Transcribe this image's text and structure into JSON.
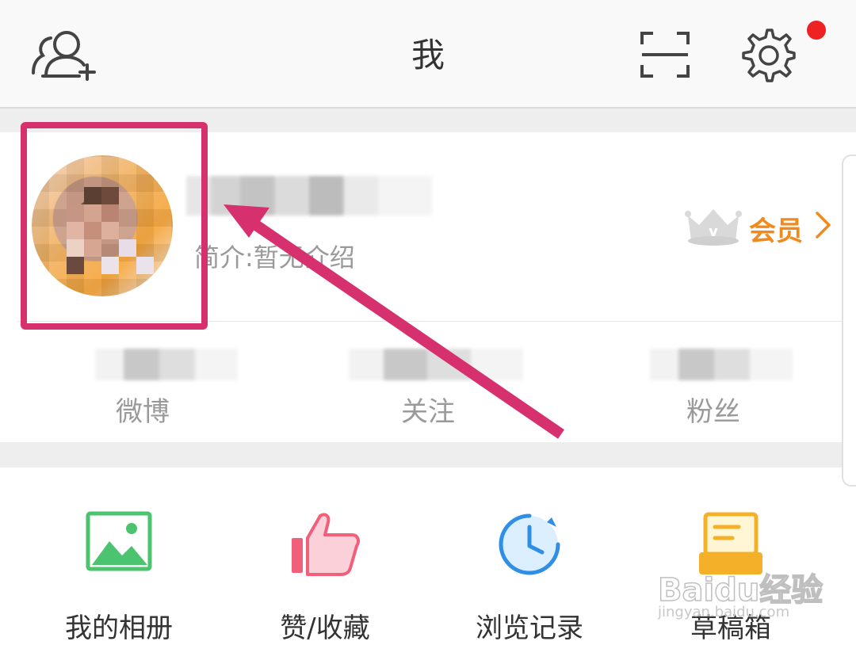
{
  "header": {
    "title": "我",
    "settings_badge_color": "#ee2222"
  },
  "profile": {
    "bio": "简介:暂无介绍",
    "vip_label": "会员",
    "accent_color": "#f08a1c"
  },
  "stats": [
    {
      "label": "微博"
    },
    {
      "label": "关注"
    },
    {
      "label": "粉丝"
    }
  ],
  "grid": [
    {
      "label": "我的相册",
      "icon": "photo-album-icon"
    },
    {
      "label": "赞/收藏",
      "icon": "thumbs-up-icon"
    },
    {
      "label": "浏览记录",
      "icon": "history-clock-icon"
    },
    {
      "label": "草稿箱",
      "icon": "drafts-icon"
    }
  ],
  "annotation": {
    "color": "#d6306e"
  },
  "watermark": {
    "text": "Baidu经验",
    "sub": "jingyan.baidu.com"
  }
}
